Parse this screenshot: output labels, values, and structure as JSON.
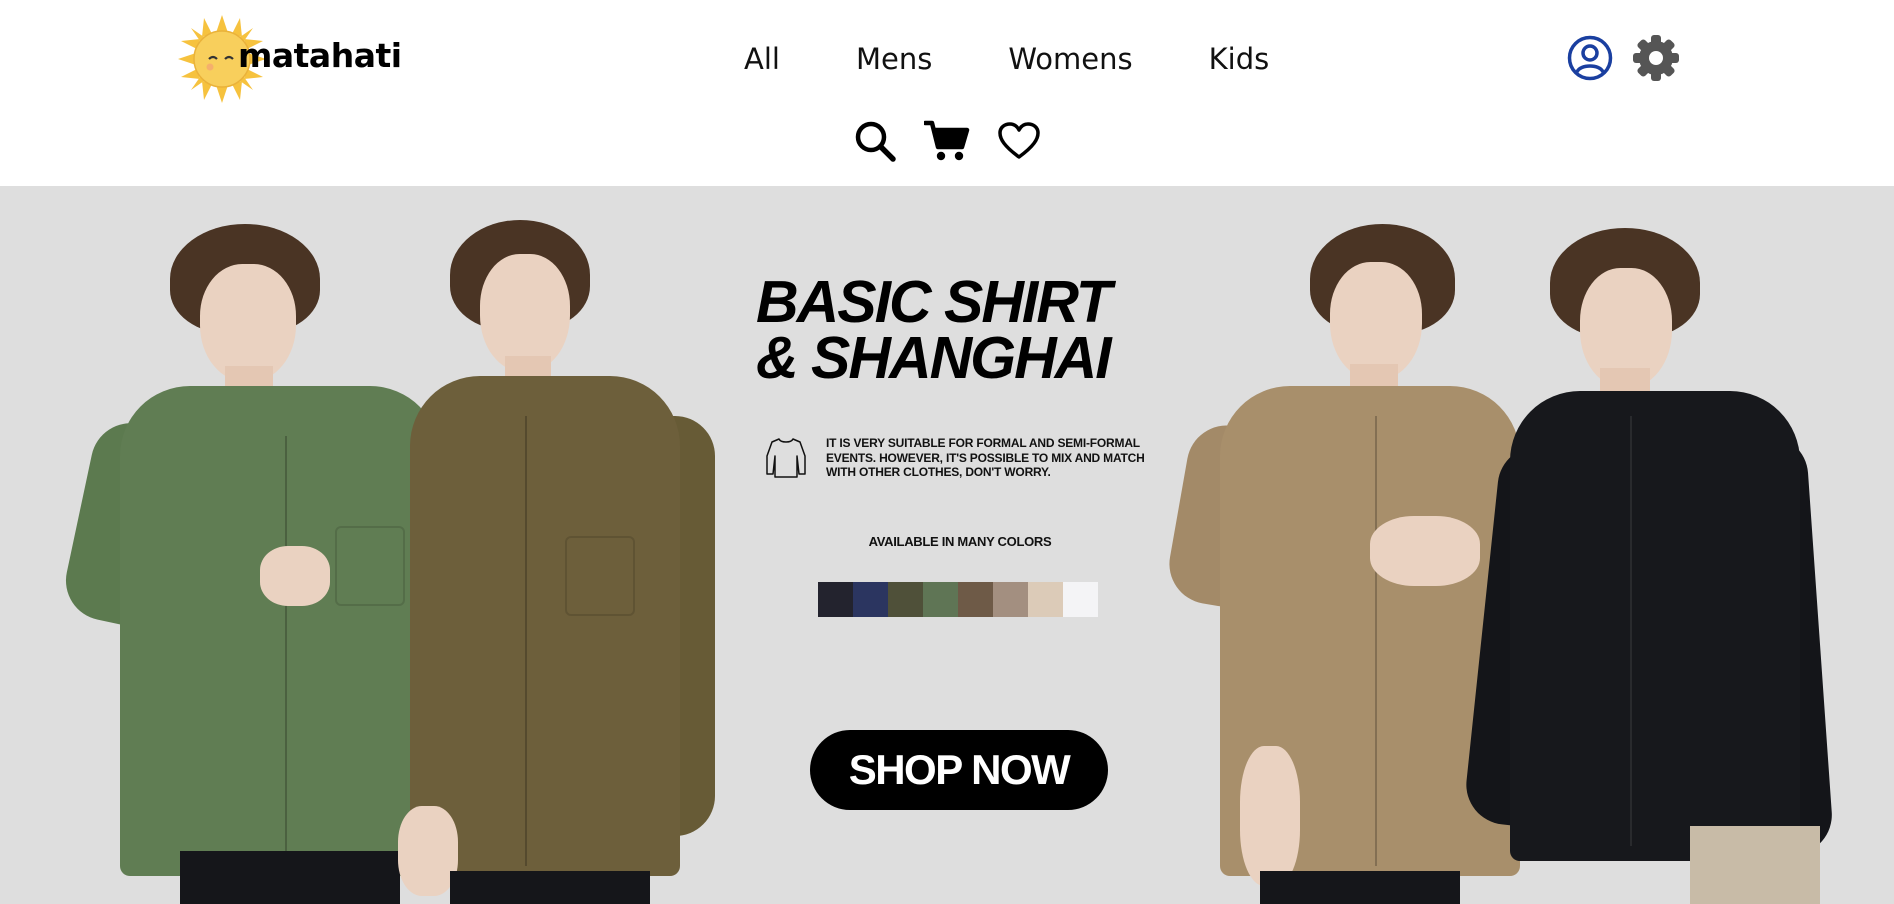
{
  "brand": {
    "name": "matahati"
  },
  "nav": {
    "items": [
      {
        "label": "All"
      },
      {
        "label": "Mens"
      },
      {
        "label": "Womens"
      },
      {
        "label": "Kids"
      }
    ]
  },
  "tools": {
    "icons": [
      "search-icon",
      "cart-icon",
      "heart-icon"
    ]
  },
  "account": {
    "icons": [
      "user-icon",
      "gear-icon"
    ],
    "user_icon_color": "#1a3fa0",
    "gear_icon_color": "#555555"
  },
  "hero": {
    "headline_line1": "BASIC SHIRT",
    "headline_line2": "& SHANGHAI",
    "description": "IT IS VERY SUITABLE FOR FORMAL AND SEMI-FORMAL EVENTS. HOWEVER, IT'S POSSIBLE TO MIX AND MATCH WITH OTHER CLOTHES, DON'T WORRY.",
    "available_label": "AVAILABLE IN MANY COLORS",
    "swatch_colors": [
      "#23232e",
      "#2b3560",
      "#4f5039",
      "#5f7555",
      "#6e5a47",
      "#a38f80",
      "#dccbb8",
      "#f4f4f6"
    ],
    "cta_label": "SHOP NOW",
    "background_color": "#dedede"
  }
}
